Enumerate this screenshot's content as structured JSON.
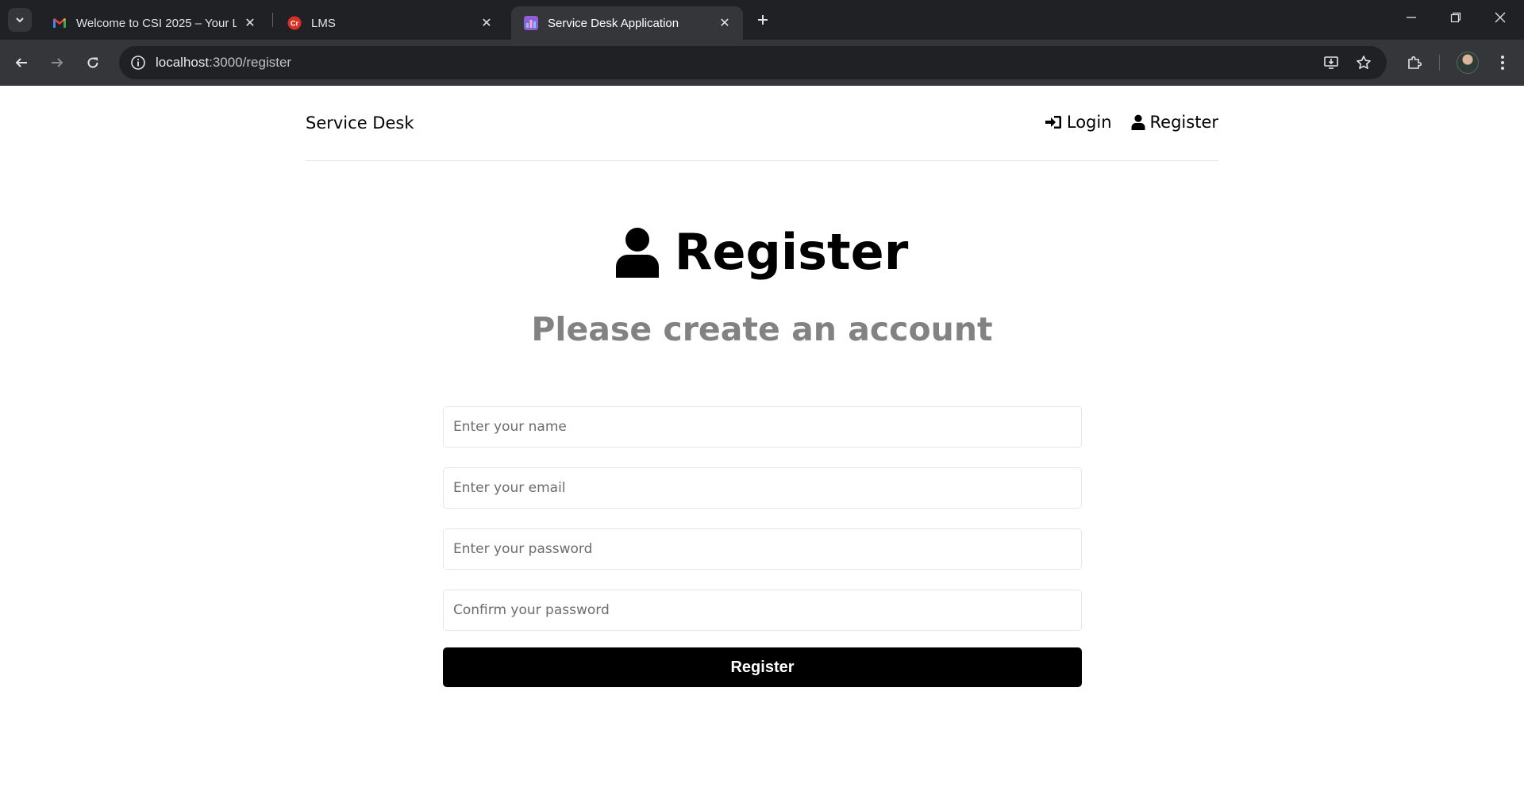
{
  "browser": {
    "tabs": [
      {
        "title": "Welcome to CSI 2025 – Your LM",
        "favicon": "gmail-icon",
        "active": false
      },
      {
        "title": "LMS",
        "favicon": "lms-icon",
        "active": false
      },
      {
        "title": "Service Desk Application",
        "favicon": "app-icon",
        "active": true
      }
    ],
    "address": {
      "host": "localhost",
      "path": ":3000/register"
    }
  },
  "app": {
    "brand": "Service Desk",
    "nav": {
      "login": "Login",
      "register": "Register"
    }
  },
  "page": {
    "heading": "Register",
    "subheading": "Please create an account"
  },
  "form": {
    "name_placeholder": "Enter your name",
    "email_placeholder": "Enter your email",
    "password_placeholder": "Enter your password",
    "confirm_placeholder": "Confirm your password",
    "submit_label": "Register"
  },
  "colors": {
    "accent": "#000000",
    "subheading": "#828282",
    "chrome_dark": "#202124",
    "chrome_mid": "#35363a"
  }
}
